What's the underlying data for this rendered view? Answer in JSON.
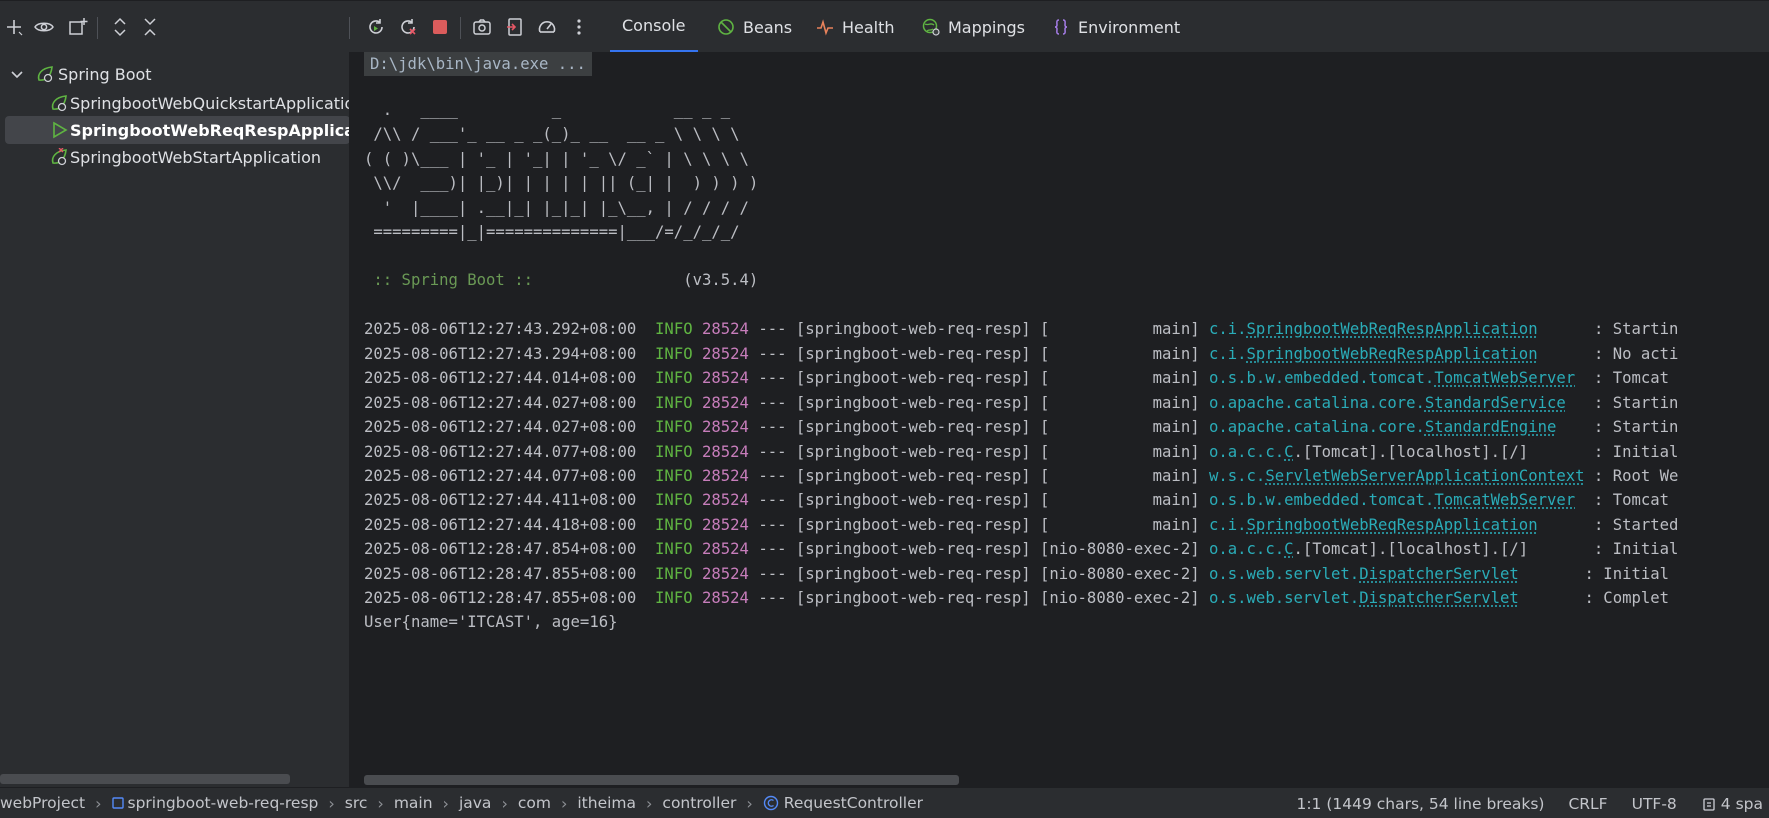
{
  "toolbar": {
    "left_icons": [
      "add-icon",
      "eye-icon",
      "new-group-icon",
      "expand-all-icon",
      "collapse-all-icon"
    ],
    "run_icons": [
      "rerun-icon",
      "rerun-failed-icon",
      "stop-icon",
      "screenshot-icon",
      "exit-icon",
      "gauge-icon",
      "more-icon"
    ],
    "tabs": [
      {
        "label": "Console",
        "icon": "console-icon",
        "active": true
      },
      {
        "label": "Beans",
        "icon": "beans-icon",
        "active": false
      },
      {
        "label": "Health",
        "icon": "health-icon",
        "active": false
      },
      {
        "label": "Mappings",
        "icon": "mappings-icon",
        "active": false
      },
      {
        "label": "Environment",
        "icon": "environment-icon",
        "active": false
      }
    ]
  },
  "tree": {
    "root": "Spring Boot",
    "items": [
      {
        "label": "SpringbootWebQuickstartApplication",
        "status": "stopped"
      },
      {
        "label": "SpringbootWebReqRespApplication",
        "status": "running"
      },
      {
        "label": "SpringbootWebStartApplication",
        "status": "error"
      }
    ]
  },
  "console": {
    "command": "D:\\jdk\\bin\\java.exe ...",
    "banner": [
      "  .   ____          _            __ _ _",
      " /\\\\ / ___'_ __ _ _(_)_ __  __ _ \\ \\ \\ \\",
      "( ( )\\___ | '_ | '_| | '_ \\/ _` | \\ \\ \\ \\",
      " \\\\/  ___)| |_)| | | | | || (_| |  ) ) ) )",
      "  '  |____| .__|_| |_|_| |_\\__, | / / / /",
      " =========|_|==============|___/=/_/_/_/"
    ],
    "spring_label": " :: Spring Boot ::",
    "spring_version": "(v3.5.4)",
    "logs": [
      {
        "ts": "2025-08-06T12:27:43.292+08:00",
        "level": "INFO",
        "pid": "28524",
        "app": "--- [springboot-web-req-resp] [           main]",
        "pkg": "c.i.",
        "cls": "SpringbootWebReqRespApplication",
        "pad": "      ",
        "msg": ": Startin"
      },
      {
        "ts": "2025-08-06T12:27:43.294+08:00",
        "level": "INFO",
        "pid": "28524",
        "app": "--- [springboot-web-req-resp] [           main]",
        "pkg": "c.i.",
        "cls": "SpringbootWebReqRespApplication",
        "pad": "      ",
        "msg": ": No acti"
      },
      {
        "ts": "2025-08-06T12:27:44.014+08:00",
        "level": "INFO",
        "pid": "28524",
        "app": "--- [springboot-web-req-resp] [           main]",
        "pkg": "o.s.b.w.embedded.tomcat.",
        "cls": "TomcatWebServer",
        "pad": "  ",
        "msg": ": Tomcat "
      },
      {
        "ts": "2025-08-06T12:27:44.027+08:00",
        "level": "INFO",
        "pid": "28524",
        "app": "--- [springboot-web-req-resp] [           main]",
        "pkg": "o.apache.catalina.core.",
        "cls": "StandardService",
        "pad": "   ",
        "msg": ": Startin"
      },
      {
        "ts": "2025-08-06T12:27:44.027+08:00",
        "level": "INFO",
        "pid": "28524",
        "app": "--- [springboot-web-req-resp] [           main]",
        "pkg": "o.apache.catalina.core.",
        "cls": "StandardEngine",
        "pad": "    ",
        "msg": ": Startin"
      },
      {
        "ts": "2025-08-06T12:27:44.077+08:00",
        "level": "INFO",
        "pid": "28524",
        "app": "--- [springboot-web-req-resp] [           main]",
        "pkg": "o.a.c.c.",
        "cls": "C",
        "pad": "",
        "msg": ".[Tomcat].[localhost].[/]       : Initial"
      },
      {
        "ts": "2025-08-06T12:27:44.077+08:00",
        "level": "INFO",
        "pid": "28524",
        "app": "--- [springboot-web-req-resp] [           main]",
        "pkg": "w.s.c.",
        "cls": "ServletWebServerApplicationContext",
        "pad": " ",
        "msg": ": Root We"
      },
      {
        "ts": "2025-08-06T12:27:44.411+08:00",
        "level": "INFO",
        "pid": "28524",
        "app": "--- [springboot-web-req-resp] [           main]",
        "pkg": "o.s.b.w.embedded.tomcat.",
        "cls": "TomcatWebServer",
        "pad": "  ",
        "msg": ": Tomcat "
      },
      {
        "ts": "2025-08-06T12:27:44.418+08:00",
        "level": "INFO",
        "pid": "28524",
        "app": "--- [springboot-web-req-resp] [           main]",
        "pkg": "c.i.",
        "cls": "SpringbootWebReqRespApplication",
        "pad": "      ",
        "msg": ": Started"
      },
      {
        "ts": "2025-08-06T12:28:47.854+08:00",
        "level": "INFO",
        "pid": "28524",
        "app": "--- [springboot-web-req-resp] [nio-8080-exec-2]",
        "pkg": "o.a.c.c.",
        "cls": "C",
        "pad": "",
        "msg": ".[Tomcat].[localhost].[/]       : Initial"
      },
      {
        "ts": "2025-08-06T12:28:47.855+08:00",
        "level": "INFO",
        "pid": "28524",
        "app": "--- [springboot-web-req-resp] [nio-8080-exec-2]",
        "pkg": "o.s.web.servlet.",
        "cls": "DispatcherServlet",
        "pad": "       ",
        "msg": ": Initial"
      },
      {
        "ts": "2025-08-06T12:28:47.855+08:00",
        "level": "INFO",
        "pid": "28524",
        "app": "--- [springboot-web-req-resp] [nio-8080-exec-2]",
        "pkg": "o.s.web.servlet.",
        "cls": "DispatcherServlet",
        "pad": "       ",
        "msg": ": Complet"
      }
    ],
    "output": "User{name='ITCAST', age=16}"
  },
  "statusbar": {
    "breadcrumbs": [
      "webProject",
      "springboot-web-req-resp",
      "src",
      "main",
      "java",
      "com",
      "itheima",
      "controller",
      "RequestController"
    ],
    "position": "1:1 (1449 chars, 54 line breaks)",
    "line_ending": "CRLF",
    "encoding": "UTF-8",
    "indent": "4 spa"
  },
  "colors": {
    "accent": "#3574f0",
    "info": "#5fb442",
    "pid": "#c77dbb",
    "logger": "#2aacb8",
    "spring": "#6a9955"
  }
}
